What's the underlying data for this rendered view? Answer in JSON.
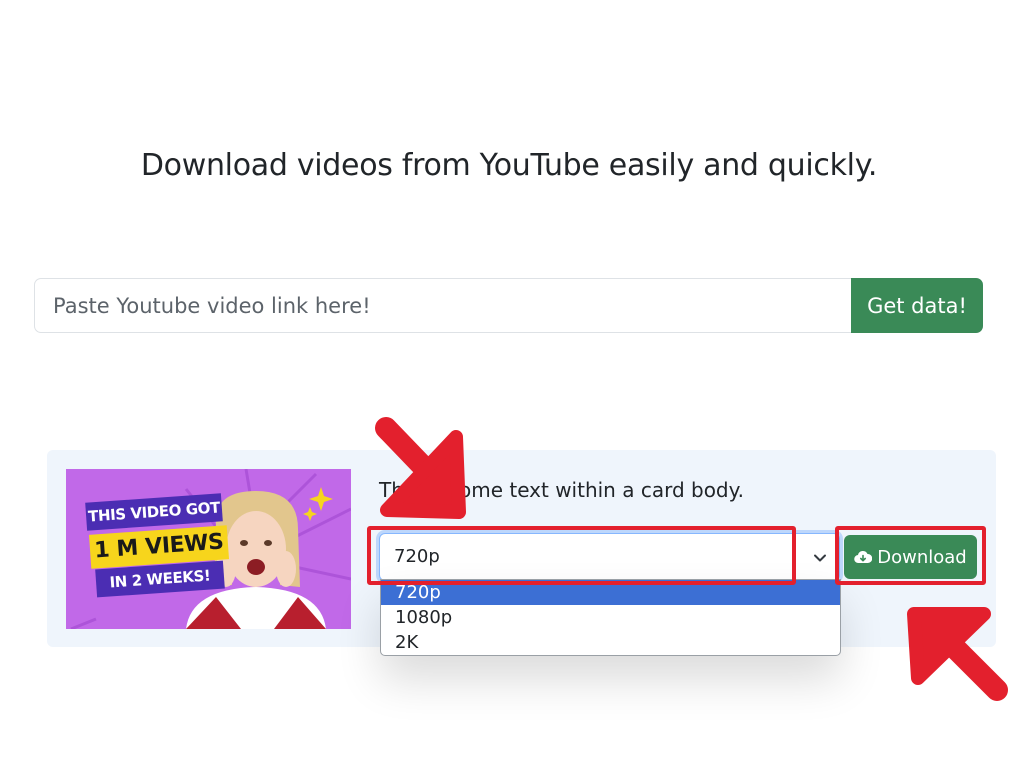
{
  "page": {
    "heading": "Download videos from YouTube easily and quickly."
  },
  "search": {
    "placeholder": "Paste Youtube video link here!",
    "value": "",
    "button_label": "Get data!"
  },
  "result_card": {
    "text": "This is some text within a card body.",
    "thumbnail": {
      "captions": [
        "THIS VIDEO GOT",
        "1 M VIEWS",
        "IN 2 WEEKS!"
      ]
    },
    "quality_select": {
      "selected": "720p",
      "options": [
        "720p",
        "1080p",
        "2K"
      ]
    },
    "download_button": {
      "label": "Download",
      "icon": "cloud-download-icon"
    }
  },
  "colors": {
    "accent_green": "#3a8a57",
    "highlight_red": "#e3202d",
    "option_highlight": "#3c6fd4"
  }
}
